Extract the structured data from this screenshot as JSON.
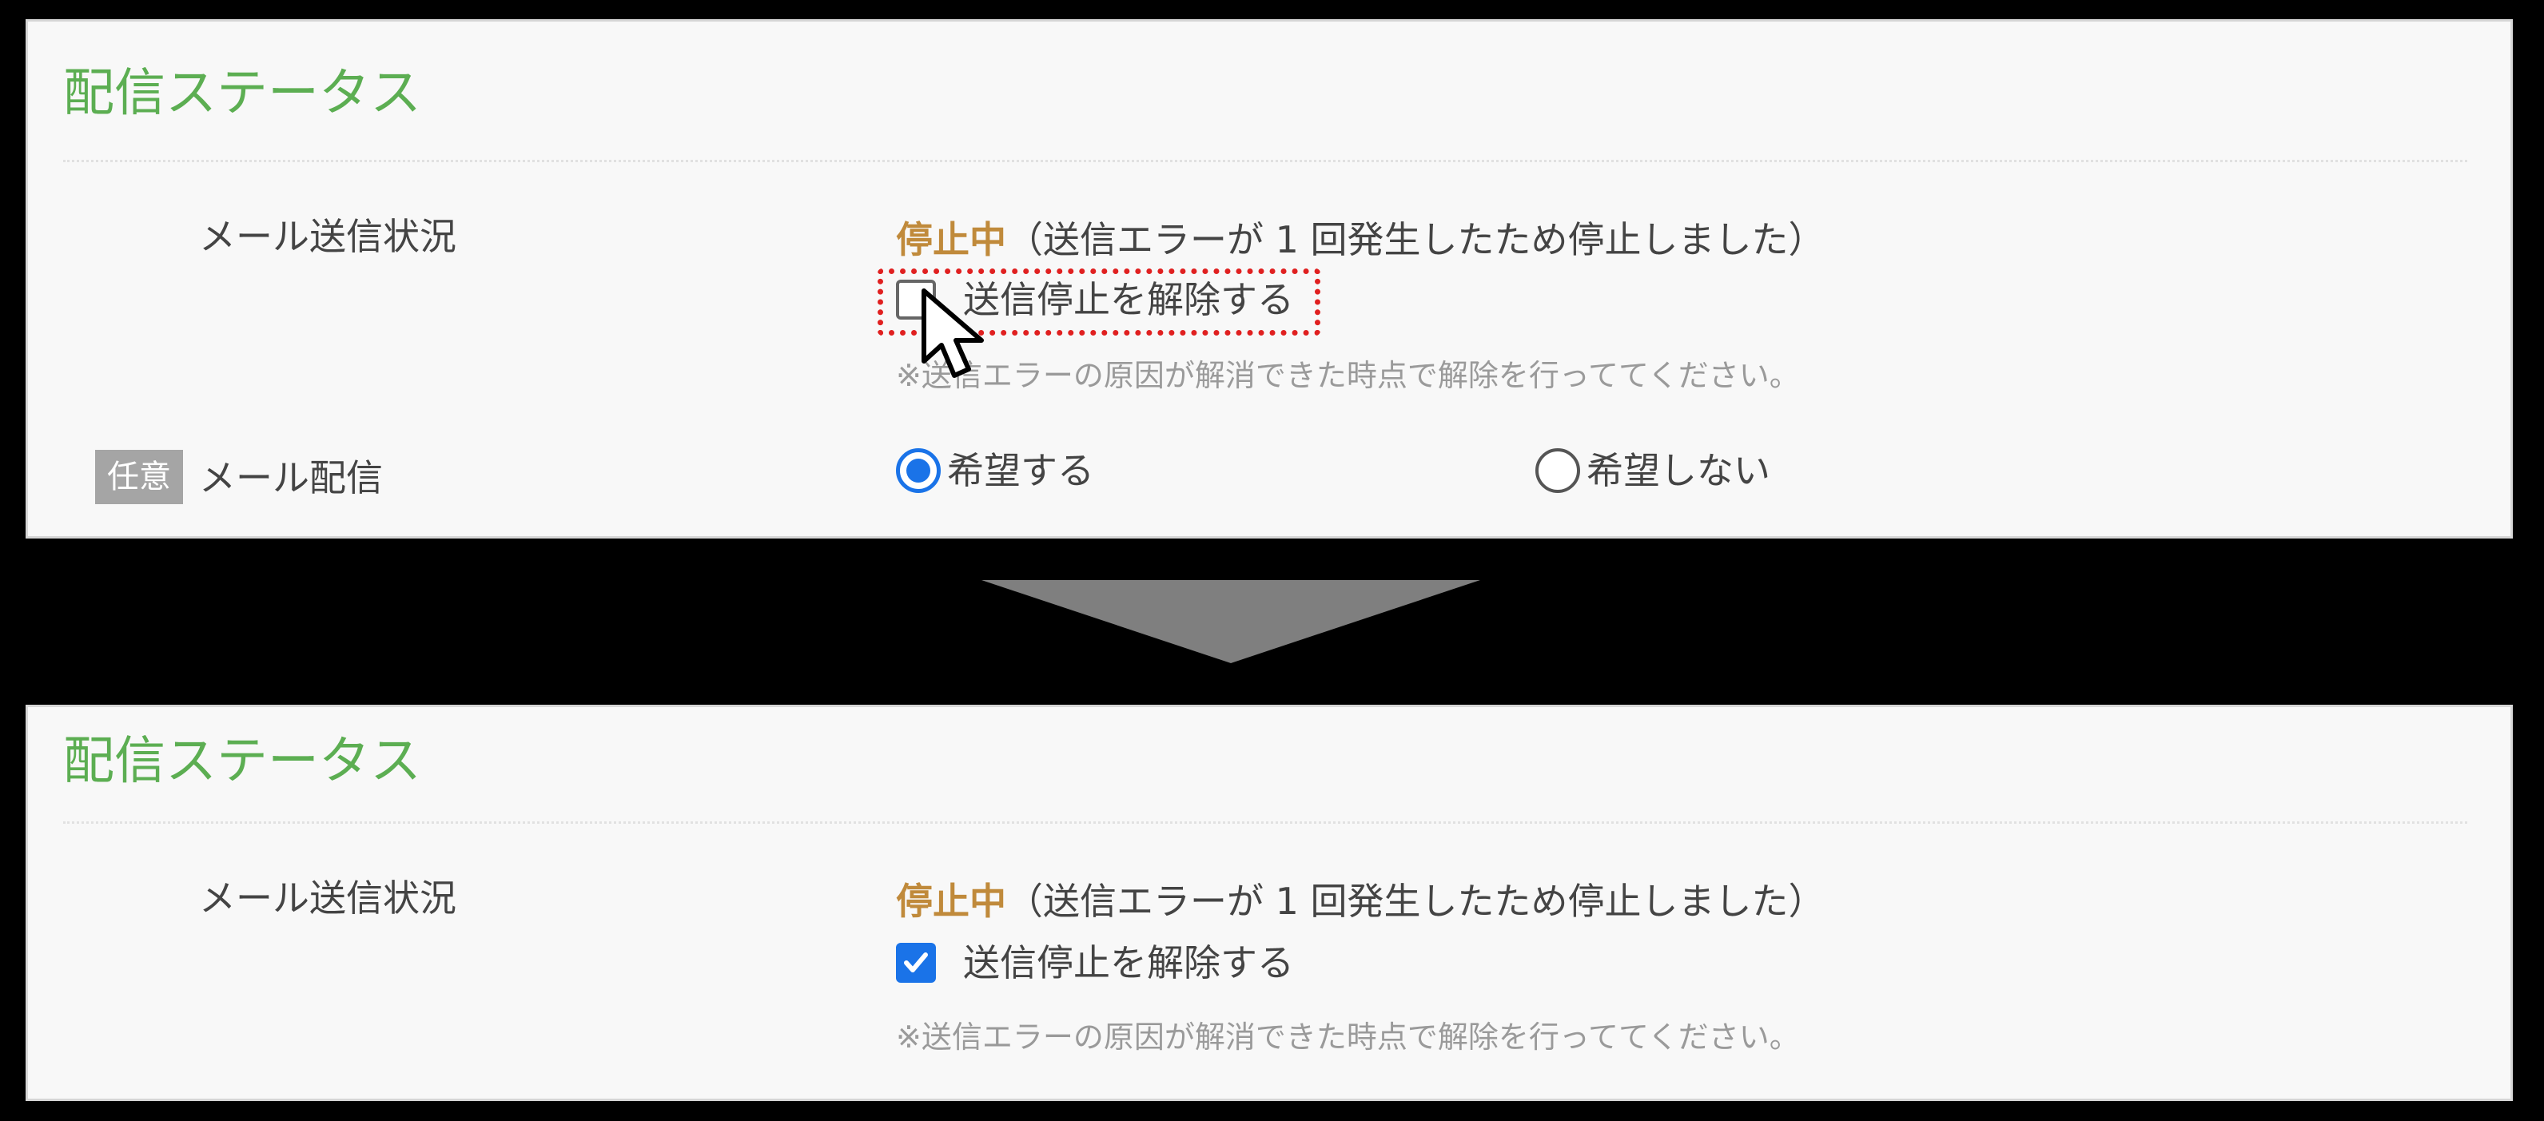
{
  "before": {
    "section_title": "配信ステータス",
    "mail_status_label": "メール送信状況",
    "status_word": "停止中",
    "status_detail": "（送信エラーが 1 回発生したため停止しました）",
    "checkbox_label": "送信停止を解除する",
    "checkbox_checked": false,
    "note": "※送信エラーの原因が解消できた時点で解除を行っててください。",
    "optional_badge": "任意",
    "mail_delivery_label": "メール配信",
    "radio_options": [
      {
        "label": "希望する",
        "selected": true
      },
      {
        "label": "希望しない",
        "selected": false
      }
    ]
  },
  "after": {
    "section_title": "配信ステータス",
    "mail_status_label": "メール送信状況",
    "status_word": "停止中",
    "status_detail": "（送信エラーが 1 回発生したため停止しました）",
    "checkbox_label": "送信停止を解除する",
    "checkbox_checked": true,
    "note": "※送信エラーの原因が解消できた時点で解除を行っててください。"
  },
  "colors": {
    "section_title": "#5cae52",
    "status_word": "#c08a3b",
    "accent_blue": "#1a73e8",
    "highlight_red": "#e02020",
    "arrow_gray": "#7f7f7f"
  },
  "icons": [
    "mouse-pointer-icon",
    "checkmark-icon",
    "down-arrow-icon"
  ]
}
